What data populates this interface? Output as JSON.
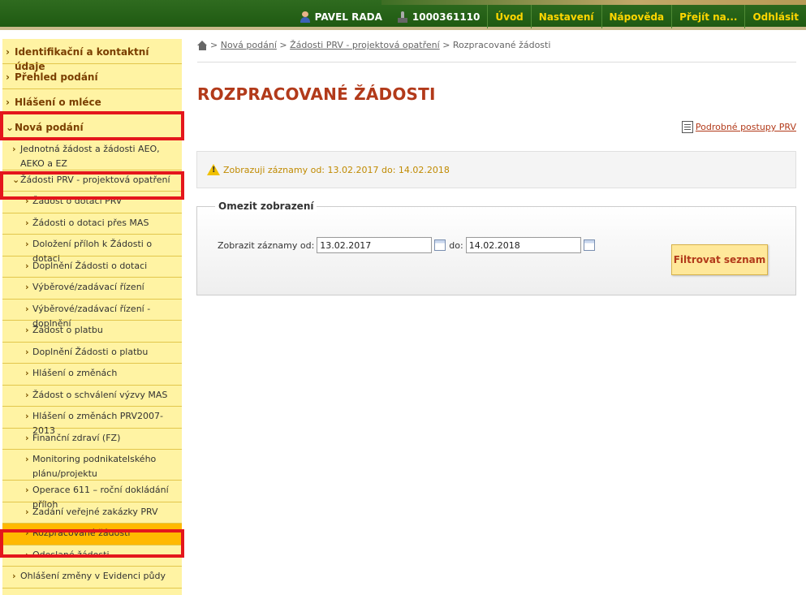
{
  "topnav": {
    "user": "PAVEL RADA",
    "account": "1000361110",
    "links": [
      "Úvod",
      "Nastavení",
      "Nápověda",
      "Přejít na...",
      "Odhlásit"
    ]
  },
  "sidebar": {
    "top_items": [
      "Identifikační a kontaktní údaje",
      "Přehled podání",
      "Hlášení o mléce",
      "Nová podání"
    ],
    "nova_podani_children": {
      "jednotna": "Jednotná žádost a žádosti AEO, AEKO a EZ",
      "prv": "Žádosti PRV - projektová opatření"
    },
    "prv_children": [
      "Žádost o dotaci PRV",
      "Žádosti o dotaci přes MAS",
      "Doložení příloh k Žádosti o dotaci",
      "Doplnění Žádosti o dotaci",
      "Výběrové/zadávací řízení",
      "Výběrové/zadávací řízení - doplnění",
      "Žádost o platbu",
      "Doplnění Žádosti o platbu",
      "Hlášení o změnách",
      "Žádost o schválení výzvy MAS",
      "Hlášení o změnách PRV2007-2013",
      "Finanční zdraví (FZ)",
      "Monitoring podnikatelského plánu/projektu",
      "Operace 611 – roční dokládání příloh",
      "Zadání veřejné zakázky PRV",
      "Rozpracované žádosti",
      "Odeslané žádosti"
    ],
    "after": "Ohlášení změny v Evidenci půdy"
  },
  "breadcrumb": {
    "sep": ">",
    "items": [
      "Nová podání",
      "Žádosti PRV - projektová opatření",
      "Rozpracované žádosti"
    ]
  },
  "page": {
    "title": "ROZPRACOVANÉ ŽÁDOSTI",
    "help_link": "Podrobné postupy PRV",
    "notice": "Zobrazuji záznamy od: 13.02.2017 do: 14.02.2018"
  },
  "filter": {
    "legend": "Omezit zobrazení",
    "from_label": "Zobrazit záznamy od:",
    "from_value": "13.02.2017",
    "to_label": "do:",
    "to_value": "14.02.2018",
    "button": "Filtrovat seznam"
  },
  "colors": {
    "header": "#1f5a12",
    "nav_link": "#ffd600",
    "sidebar": "#fff3a3",
    "sidebar_active": "#ffb900",
    "title": "#b23a1a",
    "highlight": "#e4161c"
  }
}
